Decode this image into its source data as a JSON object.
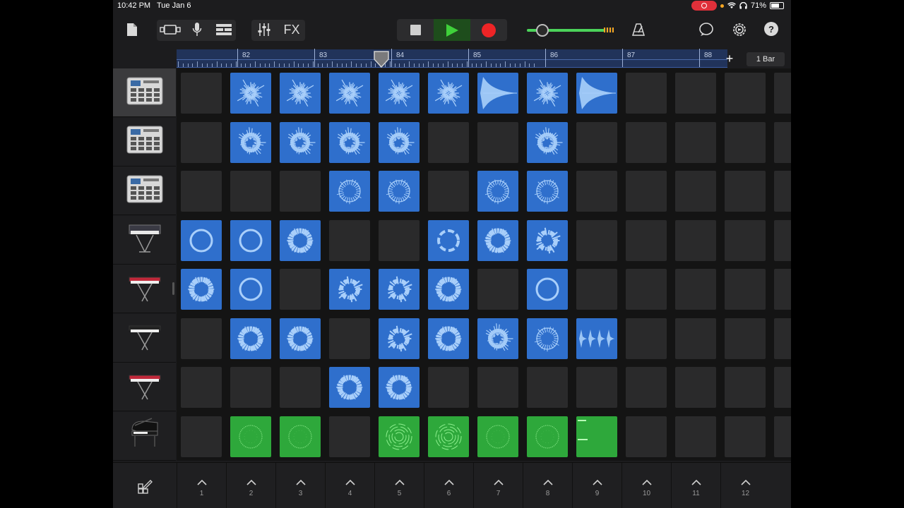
{
  "status_bar": {
    "time": "10:42 PM",
    "date": "Tue Jan 6",
    "battery": "71%"
  },
  "toolbar": {
    "left_icons": [
      "document-icon",
      "tracks-view-icon",
      "microphone-icon",
      "smart-controls-icon",
      "mixer-icon"
    ],
    "fx_label": "FX",
    "right_icons": [
      "metronome-icon",
      "loop-browser-icon",
      "settings-icon",
      "help-icon"
    ],
    "help_label": "?"
  },
  "transport": {
    "stop": "stop-icon",
    "play": "play-icon",
    "record": "record-icon",
    "master_volume": 0.18
  },
  "ruler": {
    "bars": [
      "82",
      "83",
      "84",
      "85",
      "86",
      "87",
      "88"
    ],
    "playhead_bar": 83.8
  },
  "add_track_label": "+",
  "bar_setting": "1 Bar",
  "tracks": [
    {
      "name": "drum-machine-1",
      "instrument": "drum-machine-icon",
      "selected": true
    },
    {
      "name": "drum-machine-2",
      "instrument": "drum-machine-icon",
      "selected": false
    },
    {
      "name": "drum-machine-3",
      "instrument": "drum-machine-icon",
      "selected": false
    },
    {
      "name": "synth-1",
      "instrument": "synth-keyboard-icon",
      "selected": false
    },
    {
      "name": "keyboard-red-1",
      "instrument": "red-keyboard-icon",
      "selected": false
    },
    {
      "name": "keyboard-black",
      "instrument": "black-keyboard-icon",
      "selected": false
    },
    {
      "name": "keyboard-red-2",
      "instrument": "red-keyboard-icon",
      "selected": false
    },
    {
      "name": "grand-piano",
      "instrument": "grand-piano-icon",
      "selected": false
    }
  ],
  "cells": [
    [
      "",
      "b-burst",
      "b-burst",
      "b-burst",
      "b-burst",
      "b-burst",
      "b-decay",
      "b-burst",
      "b-decay",
      "",
      "",
      "",
      ""
    ],
    [
      "",
      "b-spiky",
      "b-spiky",
      "b-spiky",
      "b-spiky",
      "",
      "",
      "b-spiky",
      "",
      "",
      "",
      "",
      ""
    ],
    [
      "",
      "",
      "",
      "b-ring",
      "b-ring",
      "",
      "b-ring",
      "b-ring",
      "",
      "",
      "",
      "",
      ""
    ],
    [
      "b-circle",
      "b-circle",
      "b-thick",
      "",
      "",
      "b-dash",
      "b-thick",
      "b-frag",
      "",
      "",
      "",
      "",
      ""
    ],
    [
      "b-thick",
      "b-circle",
      "",
      "b-frag",
      "b-frag",
      "b-thick",
      "",
      "b-circle",
      "",
      "",
      "",
      "",
      ""
    ],
    [
      "",
      "b-thick",
      "b-thick",
      "",
      "b-frag",
      "b-thick",
      "b-spiky",
      "b-ring",
      "b-pulse",
      "",
      "",
      "",
      ""
    ],
    [
      "",
      "",
      "",
      "b-thick",
      "b-thick",
      "",
      "",
      "",
      "",
      "",
      "",
      "",
      ""
    ],
    [
      "",
      "g-dots",
      "g-dots",
      "",
      "g-rings",
      "g-rings",
      "g-dots",
      "g-dots",
      "g-notes",
      "",
      "",
      "",
      ""
    ]
  ],
  "scenes": [
    "1",
    "2",
    "3",
    "4",
    "5",
    "6",
    "7",
    "8",
    "9",
    "10",
    "11",
    "12"
  ],
  "colors": {
    "clip_blue": "#2f6fcc",
    "clip_green": "#2ea83b",
    "play_green": "#3fd13a",
    "record_red": "#ee2426"
  }
}
